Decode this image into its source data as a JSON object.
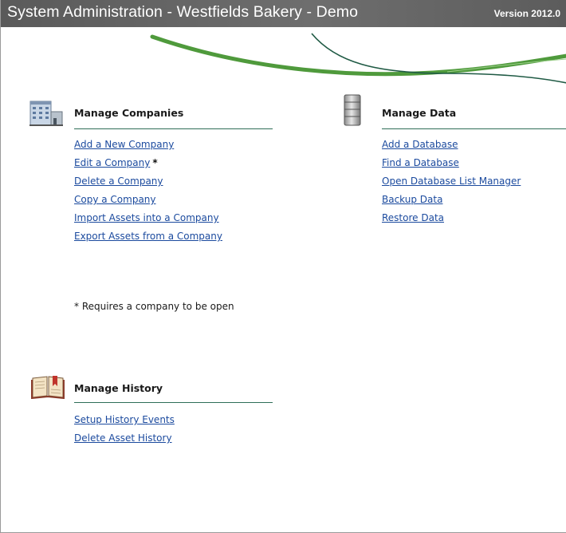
{
  "window": {
    "title": "System Administration - Westfields Bakery - Demo",
    "version": "Version 2012.0"
  },
  "companies": {
    "heading": "Manage Companies",
    "icon": "building-icon",
    "links": [
      {
        "label": "Add a New Company"
      },
      {
        "label": "Edit a Company",
        "marker": "*"
      },
      {
        "label": "Delete a Company"
      },
      {
        "label": "Copy a Company"
      },
      {
        "label": "Import Assets into a Company"
      },
      {
        "label": "Export Assets from a Company"
      }
    ],
    "note": "* Requires a company to be open"
  },
  "data": {
    "heading": "Manage Data",
    "icon": "database-icon",
    "links": [
      {
        "label": "Add a Database"
      },
      {
        "label": "Find a Database"
      },
      {
        "label": "Open Database List Manager"
      },
      {
        "label": "Backup Data"
      },
      {
        "label": "Restore Data"
      }
    ]
  },
  "history": {
    "heading": "Manage History",
    "icon": "book-icon",
    "links": [
      {
        "label": "Setup History Events"
      },
      {
        "label": "Delete Asset History"
      }
    ]
  },
  "colors": {
    "link": "#1b4a9e",
    "rule": "#2f6e58",
    "swoosh_green": "#4f9a3c",
    "swoosh_dark": "#1f5a44",
    "titlebar": "#666666"
  }
}
